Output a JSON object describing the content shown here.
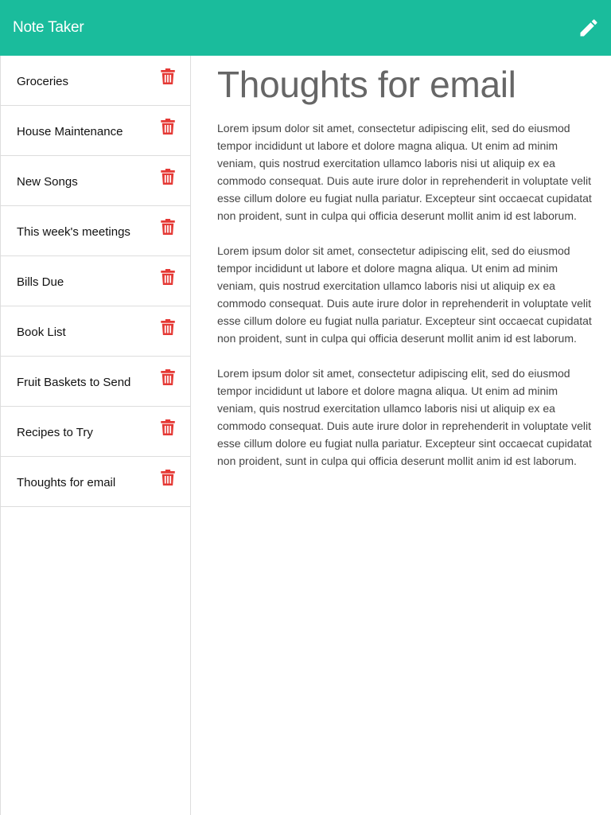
{
  "app": {
    "title": "Note Taker",
    "brand_color": "#1abc9c",
    "new_note_icon": "pencil-icon",
    "delete_icon": "trash-icon",
    "delete_color": "#e53935"
  },
  "sidebar": {
    "items": [
      {
        "title": "Groceries"
      },
      {
        "title": "House Maintenance"
      },
      {
        "title": "New Songs"
      },
      {
        "title": "This week's meetings"
      },
      {
        "title": "Bills Due"
      },
      {
        "title": "Book List"
      },
      {
        "title": "Fruit Baskets to Send"
      },
      {
        "title": "Recipes to Try"
      },
      {
        "title": "Thoughts for email"
      }
    ]
  },
  "note": {
    "title": "Thoughts for email",
    "paragraphs": [
      "Lorem ipsum dolor sit amet, consectetur adipiscing elit, sed do eiusmod tempor incididunt ut labore et dolore magna aliqua. Ut enim ad minim veniam, quis nostrud exercitation ullamco laboris nisi ut aliquip ex ea commodo consequat. Duis aute irure dolor in reprehenderit in voluptate velit esse cillum dolore eu fugiat nulla pariatur. Excepteur sint occaecat cupidatat non proident, sunt in culpa qui officia deserunt mollit anim id est laborum.",
      "Lorem ipsum dolor sit amet, consectetur adipiscing elit, sed do eiusmod tempor incididunt ut labore et dolore magna aliqua. Ut enim ad minim veniam, quis nostrud exercitation ullamco laboris nisi ut aliquip ex ea commodo consequat. Duis aute irure dolor in reprehenderit in voluptate velit esse cillum dolore eu fugiat nulla pariatur. Excepteur sint occaecat cupidatat non proident, sunt in culpa qui officia deserunt mollit anim id est laborum.",
      "Lorem ipsum dolor sit amet, consectetur adipiscing elit, sed do eiusmod tempor incididunt ut labore et dolore magna aliqua. Ut enim ad minim veniam, quis nostrud exercitation ullamco laboris nisi ut aliquip ex ea commodo consequat. Duis aute irure dolor in reprehenderit in voluptate velit esse cillum dolore eu fugiat nulla pariatur. Excepteur sint occaecat cupidatat non proident, sunt in culpa qui officia deserunt mollit anim id est laborum."
    ]
  }
}
